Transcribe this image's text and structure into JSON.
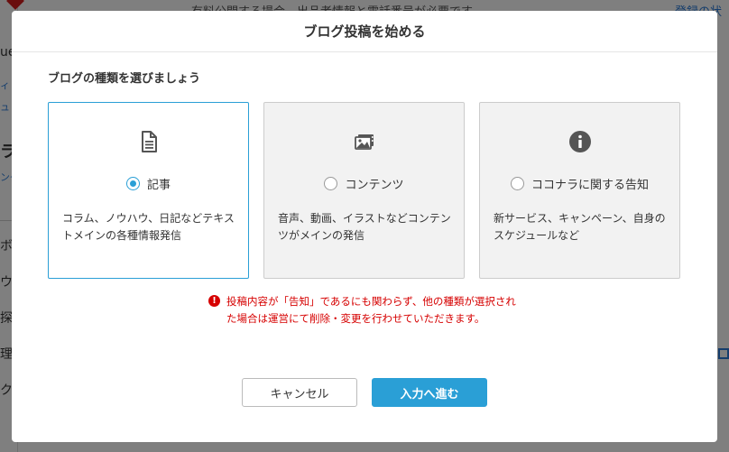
{
  "background": {
    "top_text": "有料公開する場合、出品者情報と電話番号が必要です",
    "top_right_text": "登録の状",
    "side_fragments": [
      "ue",
      "ィ",
      "ュ",
      "ラ",
      "ング",
      "ボ",
      "ウ",
      "探案",
      "理",
      "ク"
    ]
  },
  "modal": {
    "title": "ブログ投稿を始める",
    "section_label": "ブログの種類を選びましょう",
    "options": [
      {
        "label": "記事",
        "description": "コラム、ノウハウ、日記などテキストメインの各種情報発信",
        "icon": "document-icon",
        "selected": true
      },
      {
        "label": "コンテンツ",
        "description": "音声、動画、イラストなどコンテンツがメインの発信",
        "icon": "media-icon",
        "selected": false
      },
      {
        "label": "ココナラに関する告知",
        "description": "新サービス、キャンペーン、自身のスケジュールなど",
        "icon": "info-icon",
        "selected": false
      }
    ],
    "warning": "投稿内容が「告知」であるにも関わらず、他の種類が選択された場合は運営にて削除・変更を行わせていただきます。",
    "cancel_label": "キャンセル",
    "next_label": "入力へ進む"
  },
  "colors": {
    "accent": "#2a9fd6",
    "warning": "#d60000"
  }
}
